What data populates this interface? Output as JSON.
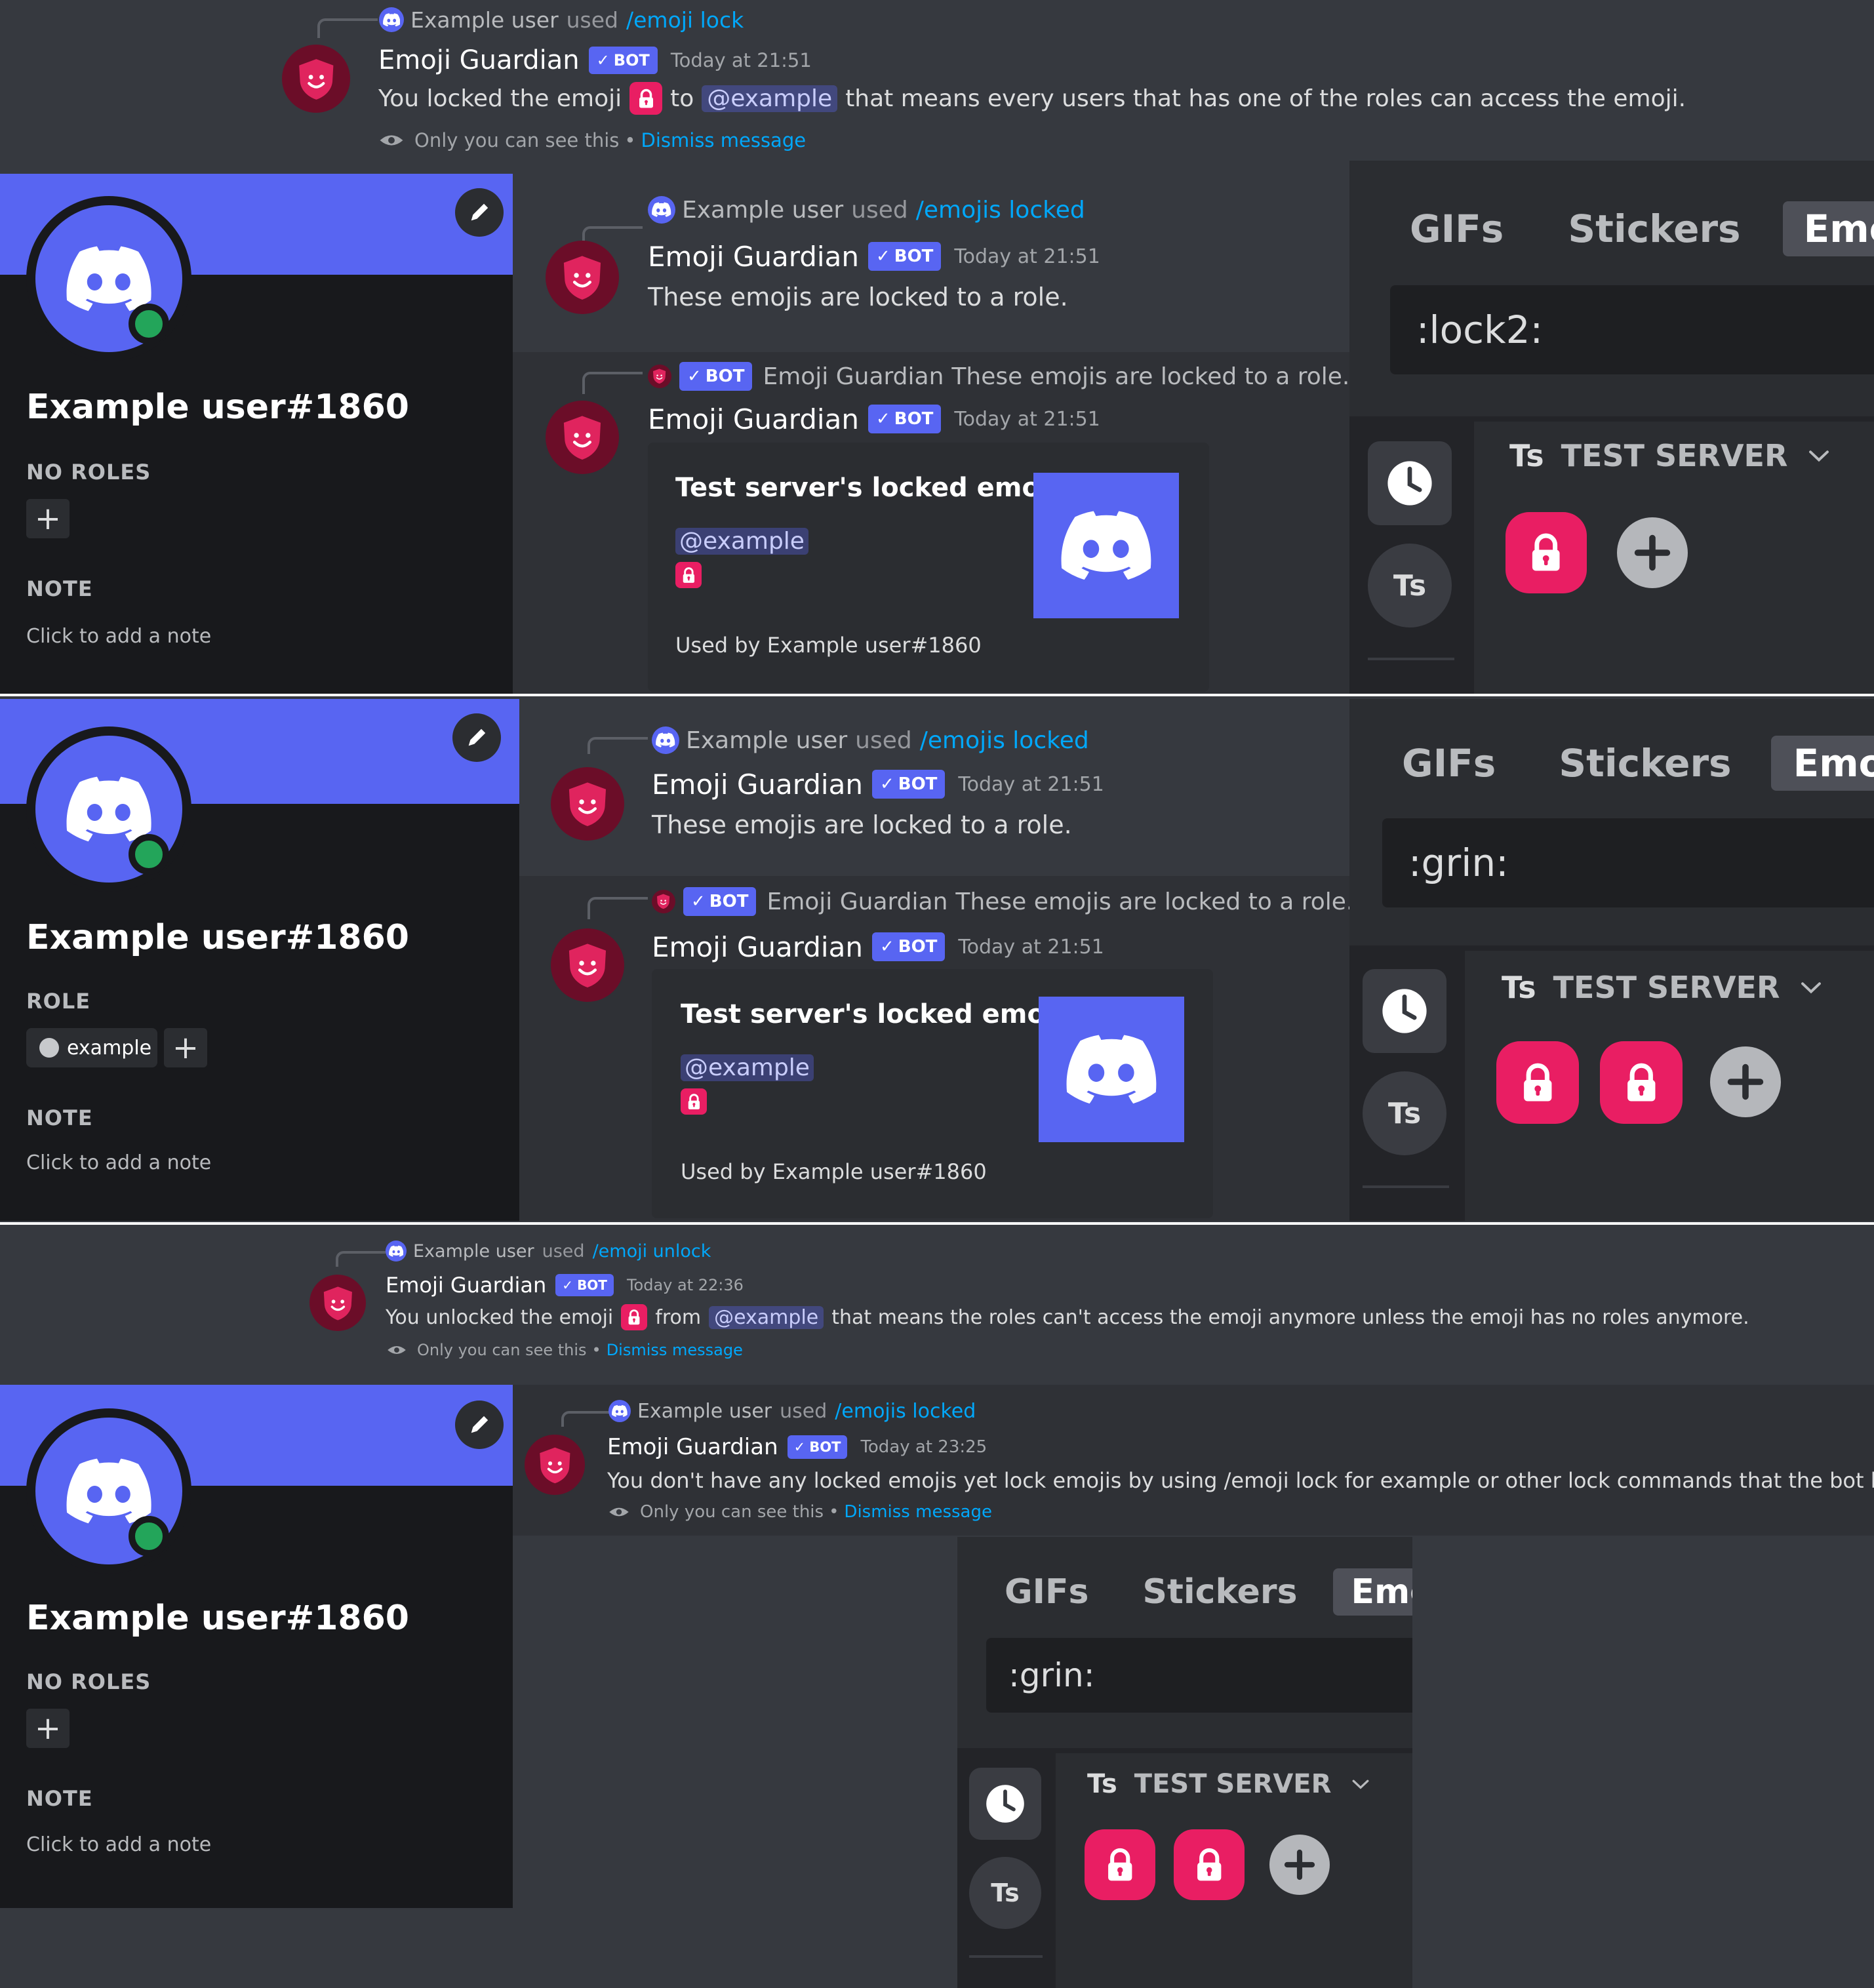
{
  "colors": {
    "blurple": "#5865f2",
    "lock_pink": "#e91e63",
    "link": "#00a8fc",
    "online": "#23a55a",
    "background": "#36393f"
  },
  "icons": {
    "command_icon": "discord-icon",
    "bot_avatar": "shield-face-icon",
    "lock_emoji": "lock-icon",
    "visibility": "eye-icon",
    "edit_profile": "pencil-icon",
    "recent": "clock-icon",
    "add_emoji": "plus-circle-icon",
    "collapse": "chevron-down-icon"
  },
  "common": {
    "bot_name": "Emoji Guardian",
    "bot_tag": "BOT",
    "user_name": "Example user",
    "used": "used",
    "mention": "@example",
    "ephemeral_note": "Only you can see this",
    "dismiss": "Dismiss message",
    "dot": "•",
    "embed_title": "Test server's locked emojis",
    "embed_footer": "Used by Example user#1860",
    "locked_reply_text": "These emojis are locked to a role.",
    "profile_username": "Example user#1860",
    "note_label": "NOTE",
    "note_placeholder": "Click to add a note",
    "plus": "+",
    "picker_tabs": [
      "GIFs",
      "Stickers",
      "Emoji"
    ],
    "server_name": "TEST SERVER",
    "server_abbr": "Ts"
  },
  "section1": {
    "command": "/emoji lock",
    "time": "Today at 21:51",
    "text_before": "You locked the emoji",
    "text_to": "to",
    "text_after": "that means every users that has one of the roles can access the emoji."
  },
  "section2": {
    "command": "/emojis locked",
    "time1": "Today at 21:51",
    "time2": "Today at 21:51",
    "roles_label": "NO ROLES",
    "search": ":lock2:",
    "locked_emoji_count": 1
  },
  "section3": {
    "command": "/emojis locked",
    "time1": "Today at 21:51",
    "time2": "Today at 21:51",
    "roles_label": "ROLE",
    "role_name": "example",
    "search": ":grin:",
    "locked_emoji_count": 2
  },
  "section4": {
    "command": "/emoji unlock",
    "time": "Today at 22:36",
    "text_before": "You unlocked the emoji",
    "text_from": "from",
    "text_after": "that means the roles can't access the emoji anymore unless the emoji has no roles anymore."
  },
  "section5": {
    "command": "/emojis locked",
    "time": "Today at 23:25",
    "text": "You don't have any locked emojis yet lock emojis by using /emoji lock for example or other lock commands that the bot has.",
    "roles_label": "NO ROLES",
    "search": ":grin:",
    "locked_emoji_count": 2
  }
}
